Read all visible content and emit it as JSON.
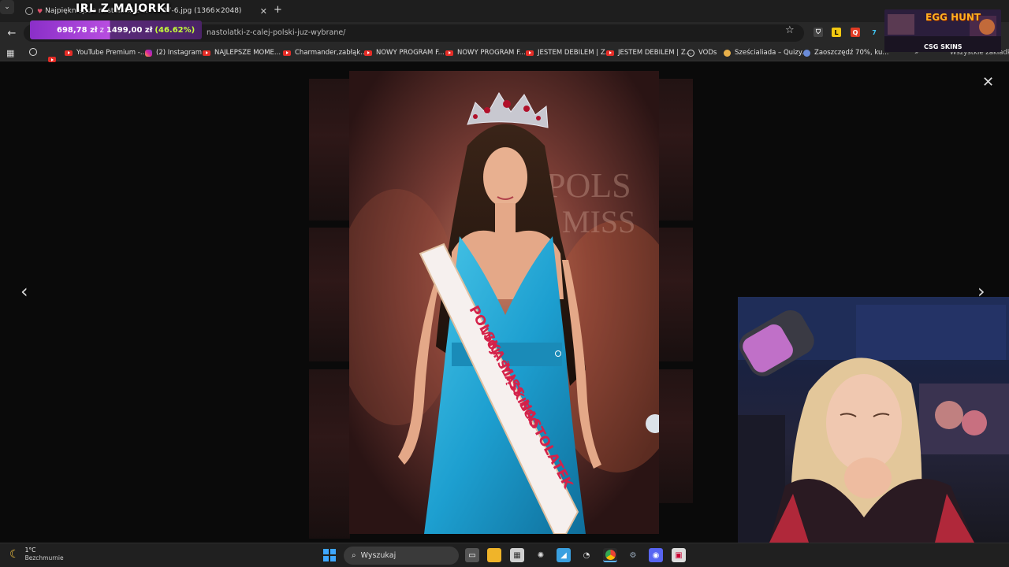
{
  "tabs": [
    {
      "title": "Najpiękniejsze nastolatki z całej Polski",
      "icon": "heart-icon"
    },
    {
      "title": "07-6.jpg (1366×2048)"
    }
  ],
  "overlay": {
    "stream_title": "IRL Z MAJORKI",
    "donation_current": "698,78 zł",
    "donation_sep": "z",
    "donation_goal": "1499,00 zł",
    "donation_percent": "(46.62%)",
    "donation_fraction": 0.4662
  },
  "address_bar": {
    "url": "nastolatki-z-calej-polski-juz-wybrane/"
  },
  "bookmarks": [
    {
      "label": "YouTube Premium -...",
      "icon": "youtube-icon"
    },
    {
      "label": "(2) Instagram",
      "icon": "instagram-icon"
    },
    {
      "label": "NAJLEPSZE MOME...",
      "icon": "youtube-icon"
    },
    {
      "label": "Charmander,zabłąk...",
      "icon": "youtube-icon"
    },
    {
      "label": "NOWY PROGRAM F...",
      "icon": "youtube-icon"
    },
    {
      "label": "NOWY PROGRAM F...",
      "icon": "youtube-icon"
    },
    {
      "label": "JESTEM DEBILEM | Z...",
      "icon": "youtube-icon"
    },
    {
      "label": "JESTEM DEBILEM | Z...",
      "icon": "youtube-icon"
    },
    {
      "label": "VODs",
      "icon": "globe-icon"
    },
    {
      "label": "Sześcialiada – Quizy...",
      "icon": "quiz-icon"
    },
    {
      "label": "Zaoszczędź 70%, ku...",
      "icon": "steam-icon"
    }
  ],
  "bookmarks_overflow": "Wszystkie zakładki",
  "photo": {
    "sash_line1": "POLSKA MISS NASTOLATEK",
    "sash_line2": "WOJ. ŚLĄSKIEGO",
    "backdrop_text": "POLS MISS"
  },
  "egg_widget": {
    "title": "EGG HUNT",
    "sponsor": "CSG SKINS"
  },
  "taskbar": {
    "temperature": "1°C",
    "weather": "Bezchmurnie",
    "search_placeholder": "Wyszukaj"
  }
}
